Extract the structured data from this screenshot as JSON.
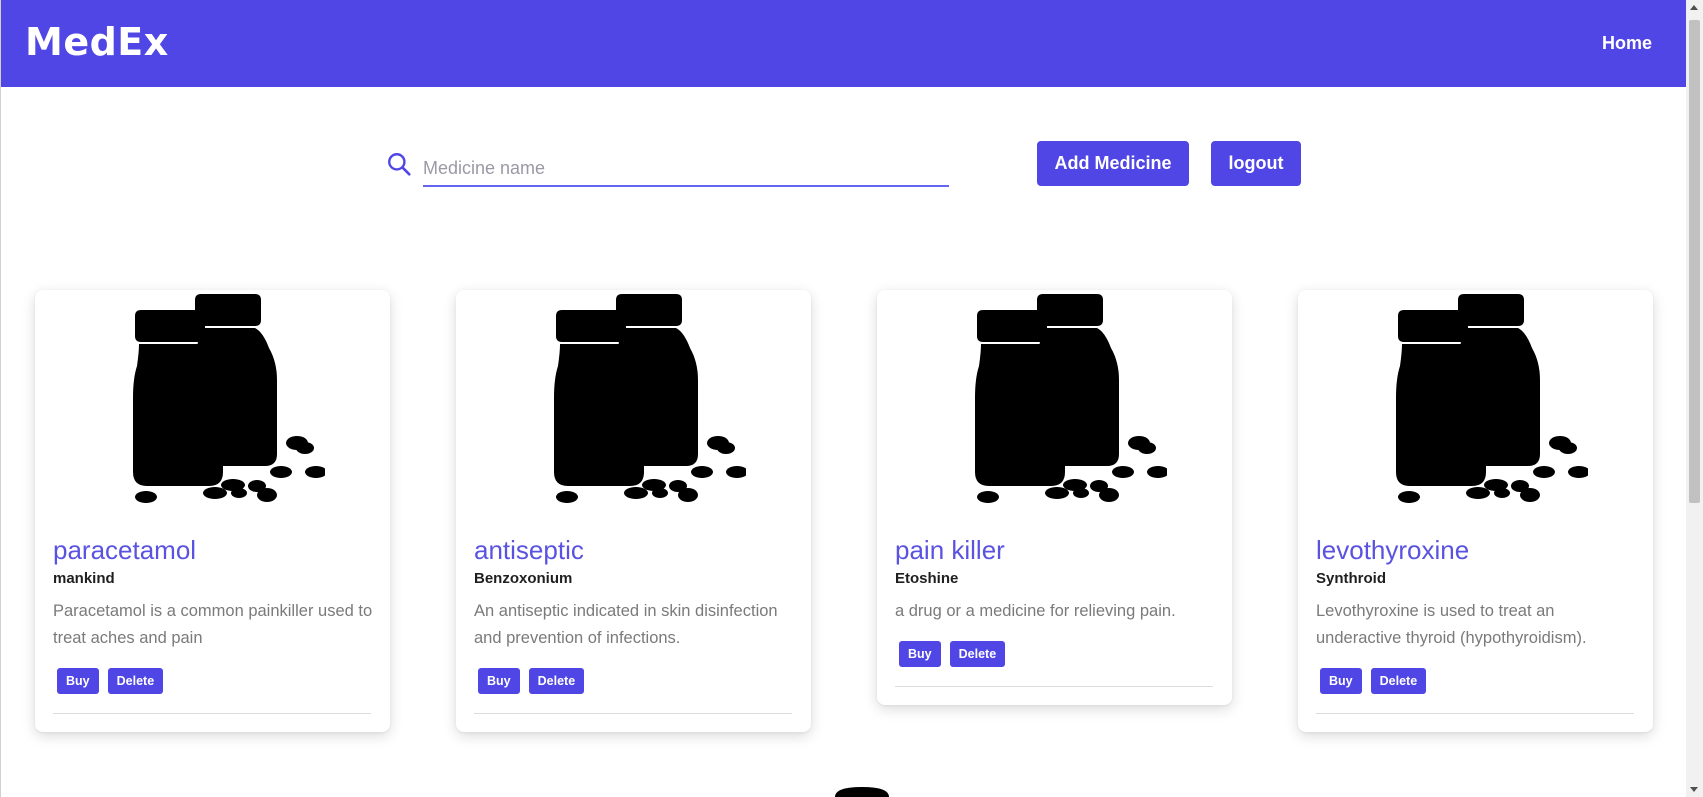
{
  "header": {
    "brand": "MedEx",
    "nav_home": "Home"
  },
  "search": {
    "placeholder": "Medicine name",
    "value": ""
  },
  "toolbar": {
    "add_label": "Add Medicine",
    "logout_label": "logout"
  },
  "cards": [
    {
      "title": "paracetamol",
      "brand": "mankind",
      "description": "Paracetamol is a common painkiller used to treat aches and pain",
      "buy_label": "Buy",
      "delete_label": "Delete"
    },
    {
      "title": "antiseptic",
      "brand": "Benzoxonium",
      "description": "An antiseptic indicated in skin disinfection and prevention of infections.",
      "buy_label": "Buy",
      "delete_label": "Delete"
    },
    {
      "title": "pain killer",
      "brand": "Etoshine",
      "description": "a drug or a medicine for relieving pain.",
      "buy_label": "Buy",
      "delete_label": "Delete"
    },
    {
      "title": "levothyroxine",
      "brand": "Synthroid",
      "description": "Levothyroxine is used to treat an underactive thyroid (hypothyroidism).",
      "buy_label": "Buy",
      "delete_label": "Delete"
    }
  ],
  "icons": {
    "search": "search-icon",
    "medicine_image": "pill-bottles-icon"
  },
  "colors": {
    "accent": "#4f46e5",
    "title": "#5a52e0"
  }
}
